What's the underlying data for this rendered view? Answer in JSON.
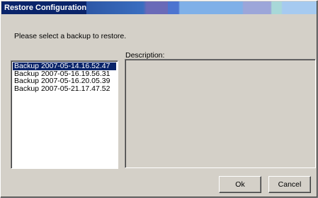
{
  "window": {
    "title": "Restore Configuration"
  },
  "prompt": "Please select a backup to restore.",
  "description_label": "Description:",
  "backups": {
    "selected_index": 0,
    "items": [
      "Backup 2007-05-14.16.52.47",
      "Backup 2007-05-16.19.56.31",
      "Backup 2007-05-16.20.05.39",
      "Backup 2007-05-21.17.47.52"
    ]
  },
  "description_text": "",
  "buttons": {
    "ok": "Ok",
    "cancel": "Cancel"
  },
  "colors": {
    "titlebar": "#0a246a",
    "selection": "#0a246a",
    "dialog_face": "#d4d0c8"
  }
}
